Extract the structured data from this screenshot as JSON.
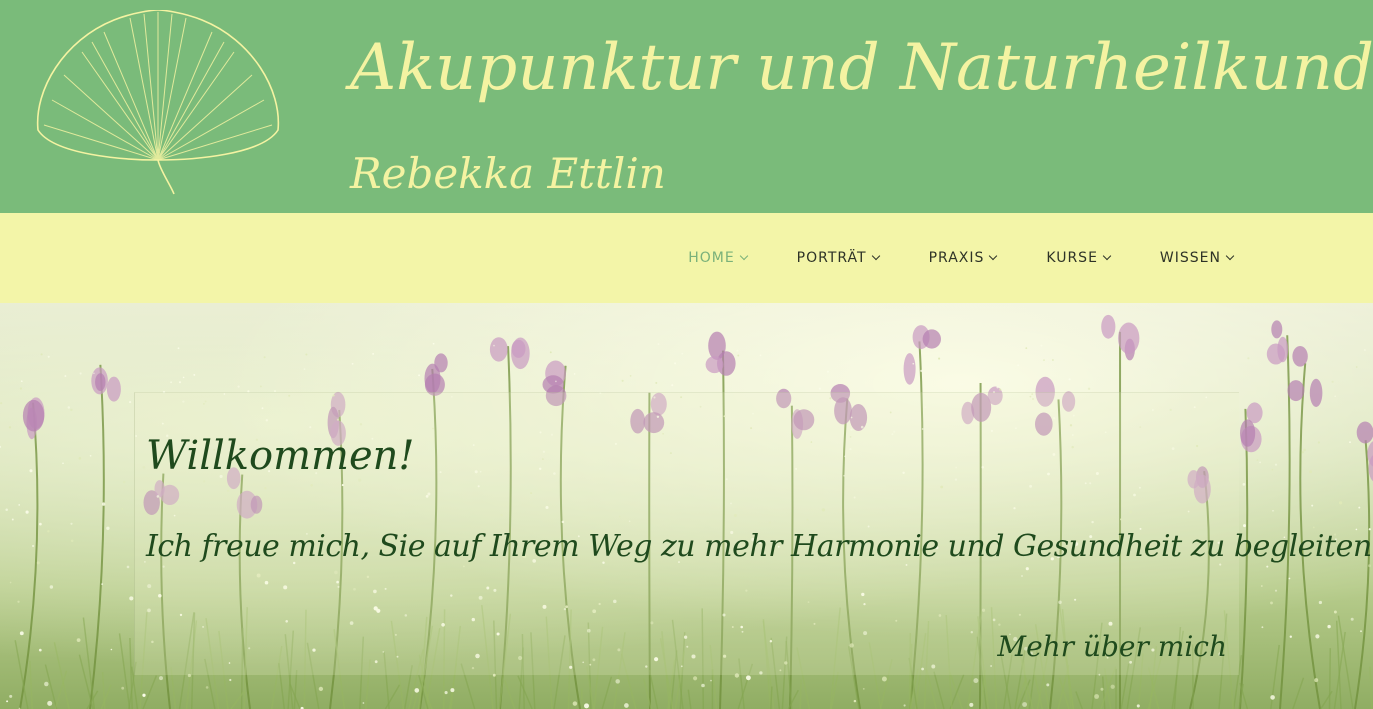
{
  "header": {
    "title": "Akupunktur und Naturheilkunde",
    "subtitle": "Rebekka Ettlin",
    "logo_icon": "ginkgo-leaf-icon",
    "background": "#7abb7a",
    "text_color": "#f4f3a2"
  },
  "nav": {
    "background": "#f3f5a8",
    "active_color": "#7ab17a",
    "items": [
      {
        "label": "HOME",
        "icon": "chevron-down-icon",
        "active": true
      },
      {
        "label": "PORTRÄT",
        "icon": "chevron-down-icon",
        "active": false
      },
      {
        "label": "PRAXIS",
        "icon": "chevron-down-icon",
        "active": false
      },
      {
        "label": "KURSE",
        "icon": "chevron-down-icon",
        "active": false
      },
      {
        "label": "WISSEN",
        "icon": "chevron-down-icon",
        "active": false
      }
    ]
  },
  "hero": {
    "background_image": "meadow-flowers-photo",
    "title": "Willkommen!",
    "text": "Ich freue mich, Sie auf Ihrem Weg zu mehr Harmonie und Gesundheit zu begleiten.",
    "link_label": "Mehr über mich",
    "text_color": "#1f4a1d"
  }
}
